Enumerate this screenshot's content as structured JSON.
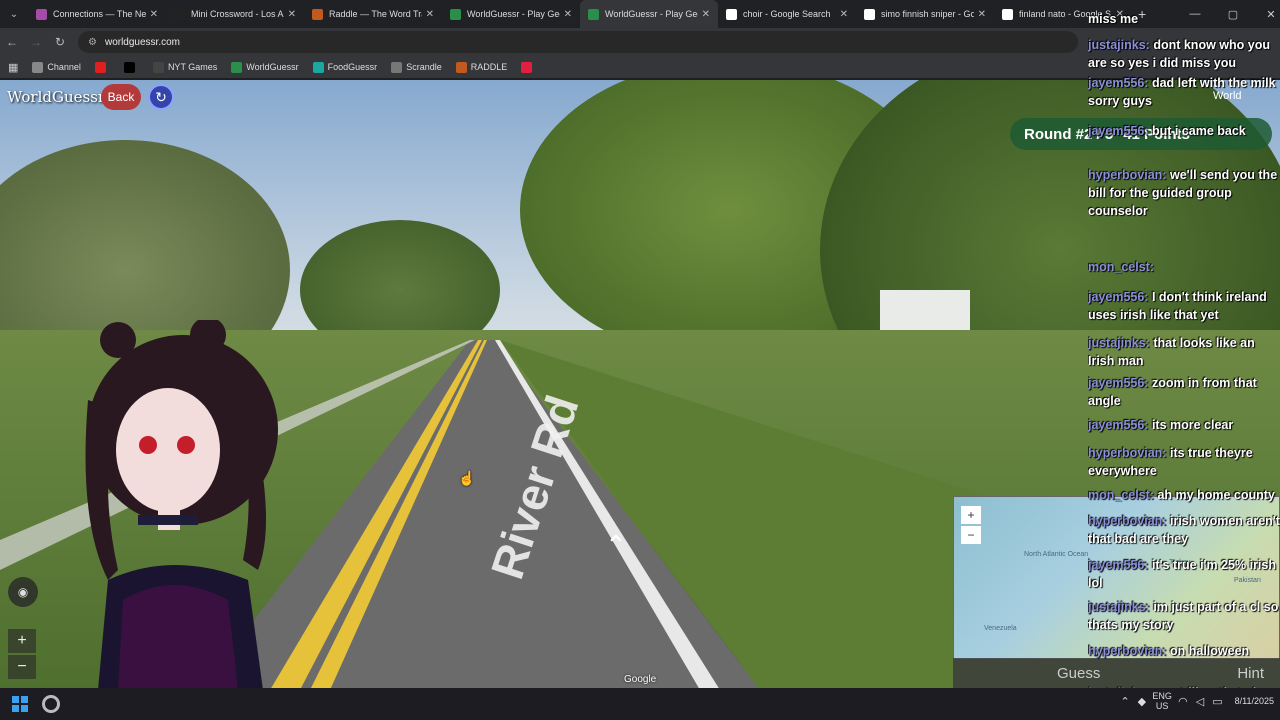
{
  "browser": {
    "tabs": [
      {
        "title": "Connections — The New",
        "favicon_color": "#a34da8"
      },
      {
        "title": "Mini Crossword - Los Ang",
        "favicon_color": "#222222"
      },
      {
        "title": "Raddle — The Word Trans",
        "favicon_color": "#c05a1f"
      },
      {
        "title": "WorldGuessr - Play Geog",
        "favicon_color": "#2a8f4a"
      },
      {
        "title": "WorldGuessr - Play Geog",
        "favicon_color": "#2a8f4a"
      },
      {
        "title": "choir - Google Search",
        "favicon_color": "#ffffff"
      },
      {
        "title": "simo finnish sniper - Goo",
        "favicon_color": "#ffffff"
      },
      {
        "title": "finland nato - Google S",
        "favicon_color": "#ffffff"
      }
    ],
    "active_tab_index": 4,
    "url": "worldguessr.com",
    "bookmarks": [
      {
        "label": "Channel",
        "color": "#888888"
      },
      {
        "label": "",
        "color": "#e02020"
      },
      {
        "label": "",
        "color": "#000000"
      },
      {
        "label": "NYT Games",
        "color": "#444444"
      },
      {
        "label": "WorldGuessr",
        "color": "#2a8f4a"
      },
      {
        "label": "FoodGuessr",
        "color": "#1aa8a0"
      },
      {
        "label": "Scrandle",
        "color": "#777777"
      },
      {
        "label": "RADDLE",
        "color": "#c05a1f"
      },
      {
        "label": "",
        "color": "#e02040"
      }
    ]
  },
  "game": {
    "logo": "WorldGuessr",
    "back_label": "Back",
    "round_label": "Round #",
    "round_value": "2 / 5",
    "points": "41 Points",
    "world_label": "World",
    "google_label": "Google",
    "guess_label": "Guess",
    "hint_label": "Hint",
    "road_text": "River Rd",
    "map_labels": [
      "North Atlantic Ocean",
      "Venezuela",
      "Turkey",
      "Pakistan"
    ]
  },
  "chat": [
    {
      "user": "",
      "text": "miss me"
    },
    {
      "user": "justajinks:",
      "text": "dont know who you are so yes i did miss you"
    },
    {
      "user": "jayem556:",
      "text": "dad left with the milk sorry guys"
    },
    {
      "user": "jayem556:",
      "text": "but i came back"
    },
    {
      "user": "hyperbovian:",
      "text": "we'll send you the bill for the guided group counselor"
    },
    {
      "user": "mon_celst:",
      "text": ""
    },
    {
      "user": "jayem556:",
      "text": "I don't think ireland uses irish like that yet"
    },
    {
      "user": "justajinks:",
      "text": "that looks like an Irish man"
    },
    {
      "user": "jayem556:",
      "text": "zoom in from that angle"
    },
    {
      "user": "jayem556:",
      "text": "its more clear"
    },
    {
      "user": "hyperbovian:",
      "text": "its true theyre everywhere"
    },
    {
      "user": "mon_celst:",
      "text": "ah my home county"
    },
    {
      "user": "hyperbovian:",
      "text": "irish women aren't that bad are they"
    },
    {
      "user": "jayem556:",
      "text": "it's true i'm 25% irish lol"
    },
    {
      "user": "justajinks:",
      "text": "im just part of a cl so thats my story"
    },
    {
      "user": "hyperbovian:",
      "text": "on halloween"
    },
    {
      "user": "justajinks:",
      "text": "n-not like...that cl"
    }
  ],
  "taskbar": {
    "lang": "ENG US",
    "time": "",
    "date": "8/11/2025"
  }
}
